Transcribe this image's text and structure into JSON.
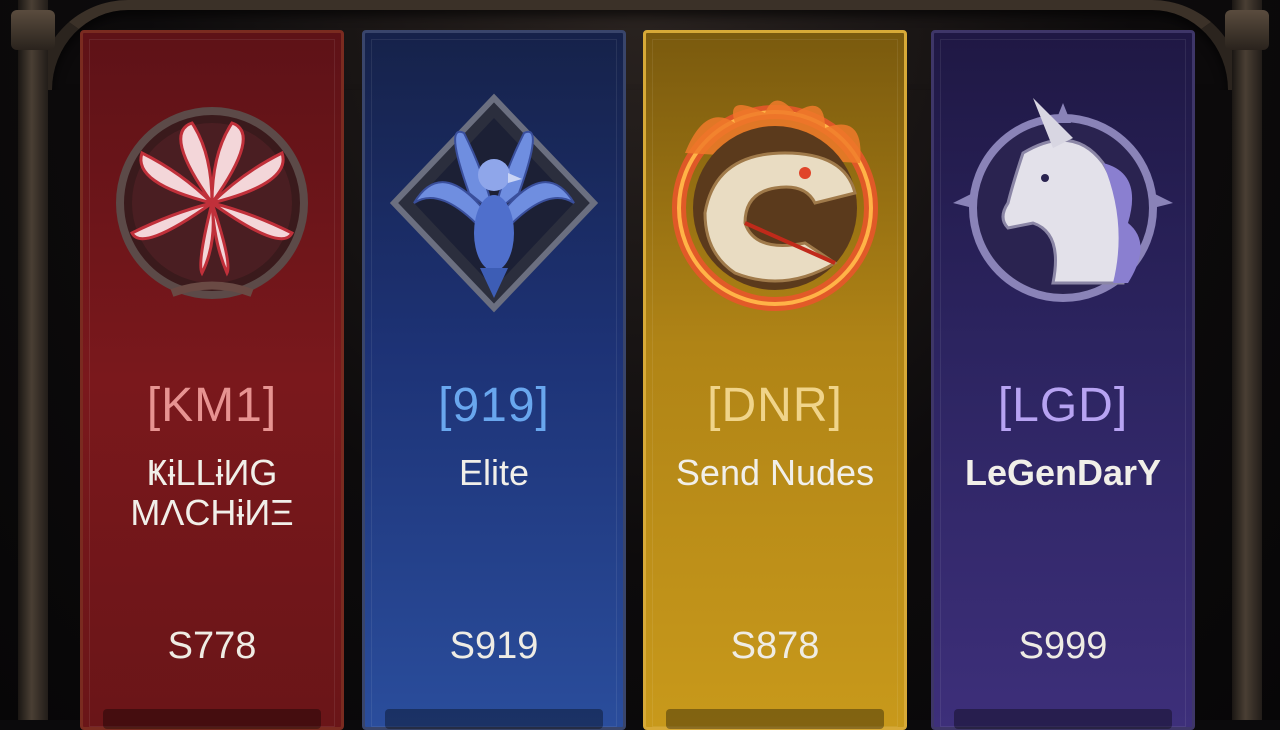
{
  "guilds": [
    {
      "tag": "[KM1]",
      "name": "ҜɨLLɨИG\nMΛCHɨИΞ",
      "server": "S778",
      "emblem": "spider-lily-emblem-icon"
    },
    {
      "tag": "[919]",
      "name": "Elite",
      "server": "S919",
      "emblem": "eagle-emblem-icon"
    },
    {
      "tag": "[DNR]",
      "name": "Send Nudes",
      "server": "S878",
      "emblem": "flaming-dragon-emblem-icon"
    },
    {
      "tag": "[LGD]",
      "name": "LeGenDarY",
      "server": "S999",
      "emblem": "unicorn-emblem-icon"
    }
  ],
  "colors": {
    "red": "#7a181c",
    "blue": "#1d3275",
    "gold": "#c8991b",
    "purple": "#2c2460"
  }
}
